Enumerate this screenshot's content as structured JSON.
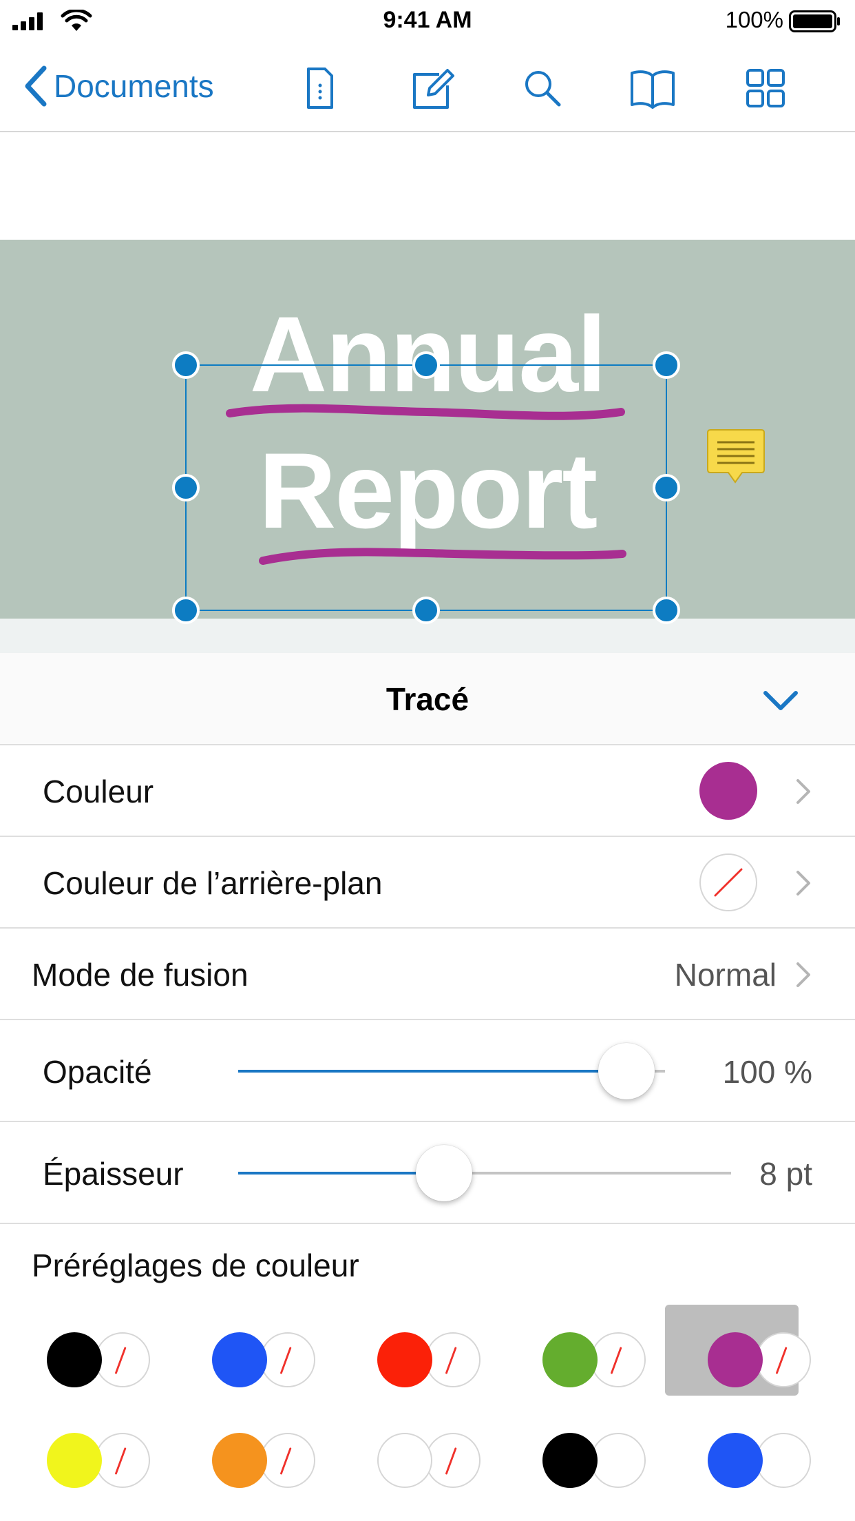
{
  "status_bar": {
    "time": "9:41 AM",
    "battery_percent": "100%"
  },
  "nav": {
    "back_label": "Documents",
    "icons": [
      "document-info-icon",
      "edit-icon",
      "search-icon",
      "bookmarks-icon",
      "thumbnails-grid-icon"
    ]
  },
  "document": {
    "title_line_1": "Annual",
    "title_line_2": "Report",
    "cover_color": "#b5c5bb",
    "ink_color": "#a82e91"
  },
  "panel": {
    "title": "Tracé",
    "color_label": "Couleur",
    "color_value": "#a82e91",
    "bg_color_label": "Couleur de l’arrière-plan",
    "bg_color_value": "none",
    "blend_label": "Mode de fusion",
    "blend_value": "Normal",
    "opacity_label": "Opacité",
    "opacity_value": "100 %",
    "opacity_fraction": 1.0,
    "thickness_label": "Épaisseur",
    "thickness_value": "8 pt",
    "thickness_fraction": 0.45,
    "presets_label": "Préréglages de couleur"
  },
  "presets": [
    {
      "fg": "#000000",
      "bg": "none",
      "selected": false
    },
    {
      "fg": "#1f55f5",
      "bg": "none",
      "selected": false
    },
    {
      "fg": "#fb2108",
      "bg": "none",
      "selected": false
    },
    {
      "fg": "#64ad2e",
      "bg": "none",
      "selected": false
    },
    {
      "fg": "#a82e91",
      "bg": "none",
      "selected": true
    },
    {
      "fg": "#f1f51c",
      "bg": "none",
      "selected": false
    },
    {
      "fg": "#f5931e",
      "bg": "none",
      "selected": false
    },
    {
      "fg": "#ffffff",
      "bg": "none",
      "selected": false
    },
    {
      "fg": "#000000",
      "bg": "#ffffff",
      "selected": false
    },
    {
      "fg": "#1f55f5",
      "bg": "#ffffff",
      "selected": false
    }
  ]
}
